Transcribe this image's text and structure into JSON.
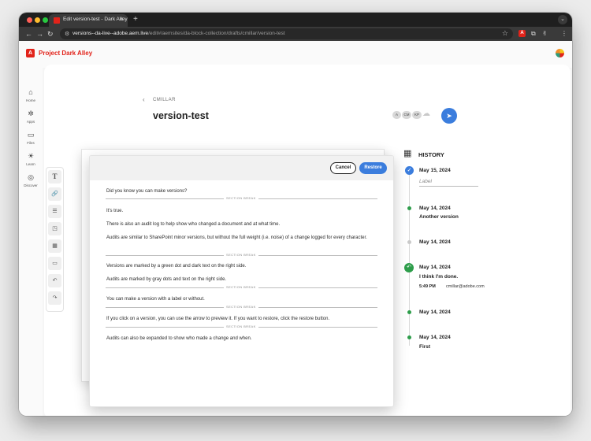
{
  "browser": {
    "tab_title": "Edit version-test - Dark Alley",
    "url_host": "versions--da-live--adobe.aem.live",
    "url_path": "/edit#/aemsites/da-block-collection/drafts/cmillar/version-test",
    "adobe_ext_label": "A"
  },
  "app": {
    "brand": "Project Dark Alley",
    "logo_letter": "A"
  },
  "rail": [
    {
      "icon": "⌂",
      "label": "Home"
    },
    {
      "icon": "✲",
      "label": "Apps"
    },
    {
      "icon": "▭",
      "label": "Files"
    },
    {
      "icon": "☀",
      "label": "Learn"
    },
    {
      "icon": "◎",
      "label": "Discover"
    }
  ],
  "doc": {
    "breadcrumb": "CMILLAR",
    "title": "version-test",
    "collaborators": [
      "A",
      "CM",
      "KP"
    ]
  },
  "preview": {
    "cancel": "Cancel",
    "restore": "Restore",
    "section_break": "SECTION BREAK",
    "lines": [
      "Did you know you can make versions?",
      "It's true.",
      "There is also an audit log to help show who changed a document and at what time.",
      "Audits are similar to SharePoint minor versions, but without the full weight (i.e. noise) of a change logged for every character.",
      "Versions are marked by a green dot and dark text on the right side.",
      "Audits are marked by gray dots and text on the right side.",
      "You can make a version with a label or without.",
      "If you click on a version, you can use the arrow to preview it. If you want to restore, click the restore button.",
      "Audits can also be expanded to show who made a change and when."
    ]
  },
  "history": {
    "title": "HISTORY",
    "label_placeholder": "Label",
    "entries": [
      {
        "date": "May 15, 2024"
      },
      {
        "date": "May 14, 2024",
        "label": "Another version"
      },
      {
        "date": "May 14, 2024"
      },
      {
        "date": "May 14, 2024",
        "label": "I think I'm done.",
        "time": "5:49 PM",
        "user": "cmillar@adobe.com"
      },
      {
        "date": "May 14, 2024"
      },
      {
        "date": "May 14, 2024",
        "label": "First"
      }
    ]
  },
  "colors": {
    "accent": "#3b7ddd",
    "brand": "#e2231a",
    "version_dot": "#2d9d4a",
    "audit_dot": "#c9c9c9"
  }
}
